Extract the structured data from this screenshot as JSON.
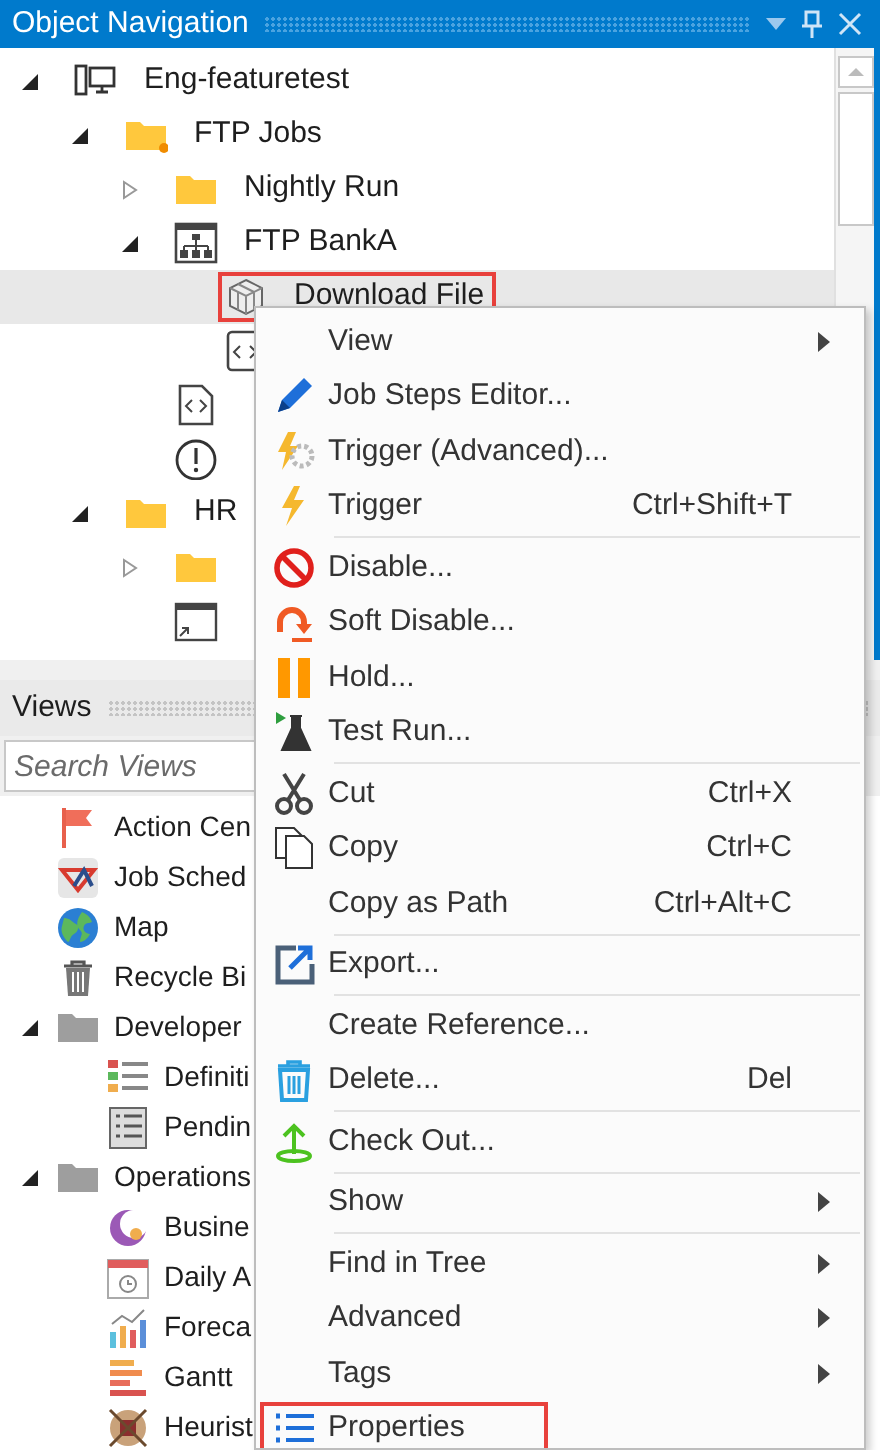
{
  "object_navigation": {
    "title": "Object Navigation",
    "tree": [
      {
        "label": "Eng-featuretest",
        "kind": "server",
        "expanded": true,
        "selected": false,
        "annotated": false,
        "children": [
          {
            "label": "FTP Jobs",
            "kind": "job-folder",
            "expanded": true,
            "selected": false,
            "annotated": false,
            "children": [
              {
                "label": "Nightly Run",
                "kind": "folder",
                "expanded": false,
                "selected": false,
                "annotated": false
              },
              {
                "label": "FTP BankA",
                "kind": "workflow",
                "expanded": true,
                "selected": false,
                "annotated": false,
                "children": [
                  {
                    "label": "Download File",
                    "kind": "task",
                    "selected": true,
                    "annotated": true
                  },
                  {
                    "kind": "script",
                    "selected": false,
                    "annotated": false
                  }
                ]
              },
              {
                "kind": "script-file",
                "selected": false,
                "annotated": false
              },
              {
                "kind": "alert",
                "selected": false,
                "annotated": false
              }
            ]
          },
          {
            "label": "HR",
            "kind": "folder",
            "expanded": true,
            "selected": false,
            "annotated": false,
            "children": [
              {
                "kind": "folder",
                "expanded": false,
                "selected": false,
                "annotated": false
              },
              {
                "kind": "window",
                "selected": false,
                "annotated": false
              }
            ]
          }
        ]
      }
    ]
  },
  "views": {
    "title": "Views",
    "search": {
      "placeholder": "Search Views"
    },
    "items": [
      {
        "label": "Action Cen",
        "kind": "flag"
      },
      {
        "label": "Job Sched",
        "kind": "scheduler"
      },
      {
        "label": "Map",
        "kind": "globe"
      },
      {
        "label": "Recycle Bi",
        "kind": "bin"
      },
      {
        "label": "Developer",
        "kind": "folder",
        "expanded": true,
        "children": [
          {
            "label": "Definiti",
            "kind": "list"
          },
          {
            "label": "Pendin",
            "kind": "checklist"
          }
        ]
      },
      {
        "label": "Operations",
        "kind": "folder",
        "expanded": true,
        "children": [
          {
            "label": "Busine",
            "kind": "moon"
          },
          {
            "label": "Daily A",
            "kind": "calendar"
          },
          {
            "label": "Foreca",
            "kind": "chart"
          },
          {
            "label": "Gantt",
            "kind": "gantt"
          },
          {
            "label": "Heurist",
            "kind": "grid"
          }
        ]
      }
    ]
  },
  "context_menu": {
    "items": [
      {
        "kind": "item",
        "label": "View",
        "submenu": true,
        "annotated": false
      },
      {
        "kind": "item",
        "label": "Job Steps Editor...",
        "submenu": false,
        "annotated": false
      },
      {
        "kind": "item",
        "label": "Trigger (Advanced)...",
        "submenu": false,
        "annotated": false
      },
      {
        "kind": "item",
        "label": "Trigger",
        "shortcut": "Ctrl+Shift+T",
        "submenu": false,
        "annotated": false
      },
      {
        "kind": "separator"
      },
      {
        "kind": "item",
        "label": "Disable...",
        "submenu": false,
        "annotated": false
      },
      {
        "kind": "item",
        "label": "Soft Disable...",
        "submenu": false,
        "annotated": false
      },
      {
        "kind": "item",
        "label": "Hold...",
        "submenu": false,
        "annotated": false
      },
      {
        "kind": "item",
        "label": "Test Run...",
        "submenu": false,
        "annotated": false
      },
      {
        "kind": "separator"
      },
      {
        "kind": "item",
        "label": "Cut",
        "shortcut": "Ctrl+X",
        "submenu": false,
        "annotated": false
      },
      {
        "kind": "item",
        "label": "Copy",
        "shortcut": "Ctrl+C",
        "submenu": false,
        "annotated": false
      },
      {
        "kind": "item",
        "label": "Copy as Path",
        "shortcut": "Ctrl+Alt+C",
        "submenu": false,
        "annotated": false
      },
      {
        "kind": "separator"
      },
      {
        "kind": "item",
        "label": "Export...",
        "submenu": false,
        "annotated": false
      },
      {
        "kind": "separator"
      },
      {
        "kind": "item",
        "label": "Create Reference...",
        "submenu": false,
        "annotated": false
      },
      {
        "kind": "item",
        "label": "Delete...",
        "shortcut": "Del",
        "submenu": false,
        "annotated": false
      },
      {
        "kind": "separator"
      },
      {
        "kind": "item",
        "label": "Check Out...",
        "submenu": false,
        "annotated": false
      },
      {
        "kind": "separator"
      },
      {
        "kind": "item",
        "label": "Show",
        "submenu": true,
        "annotated": false
      },
      {
        "kind": "separator"
      },
      {
        "kind": "item",
        "label": "Find in Tree",
        "submenu": true,
        "annotated": false
      },
      {
        "kind": "item",
        "label": "Advanced",
        "submenu": true,
        "annotated": false
      },
      {
        "kind": "item",
        "label": "Tags",
        "submenu": true,
        "annotated": false
      },
      {
        "kind": "item",
        "label": "Properties",
        "submenu": false,
        "annotated": true
      }
    ]
  }
}
